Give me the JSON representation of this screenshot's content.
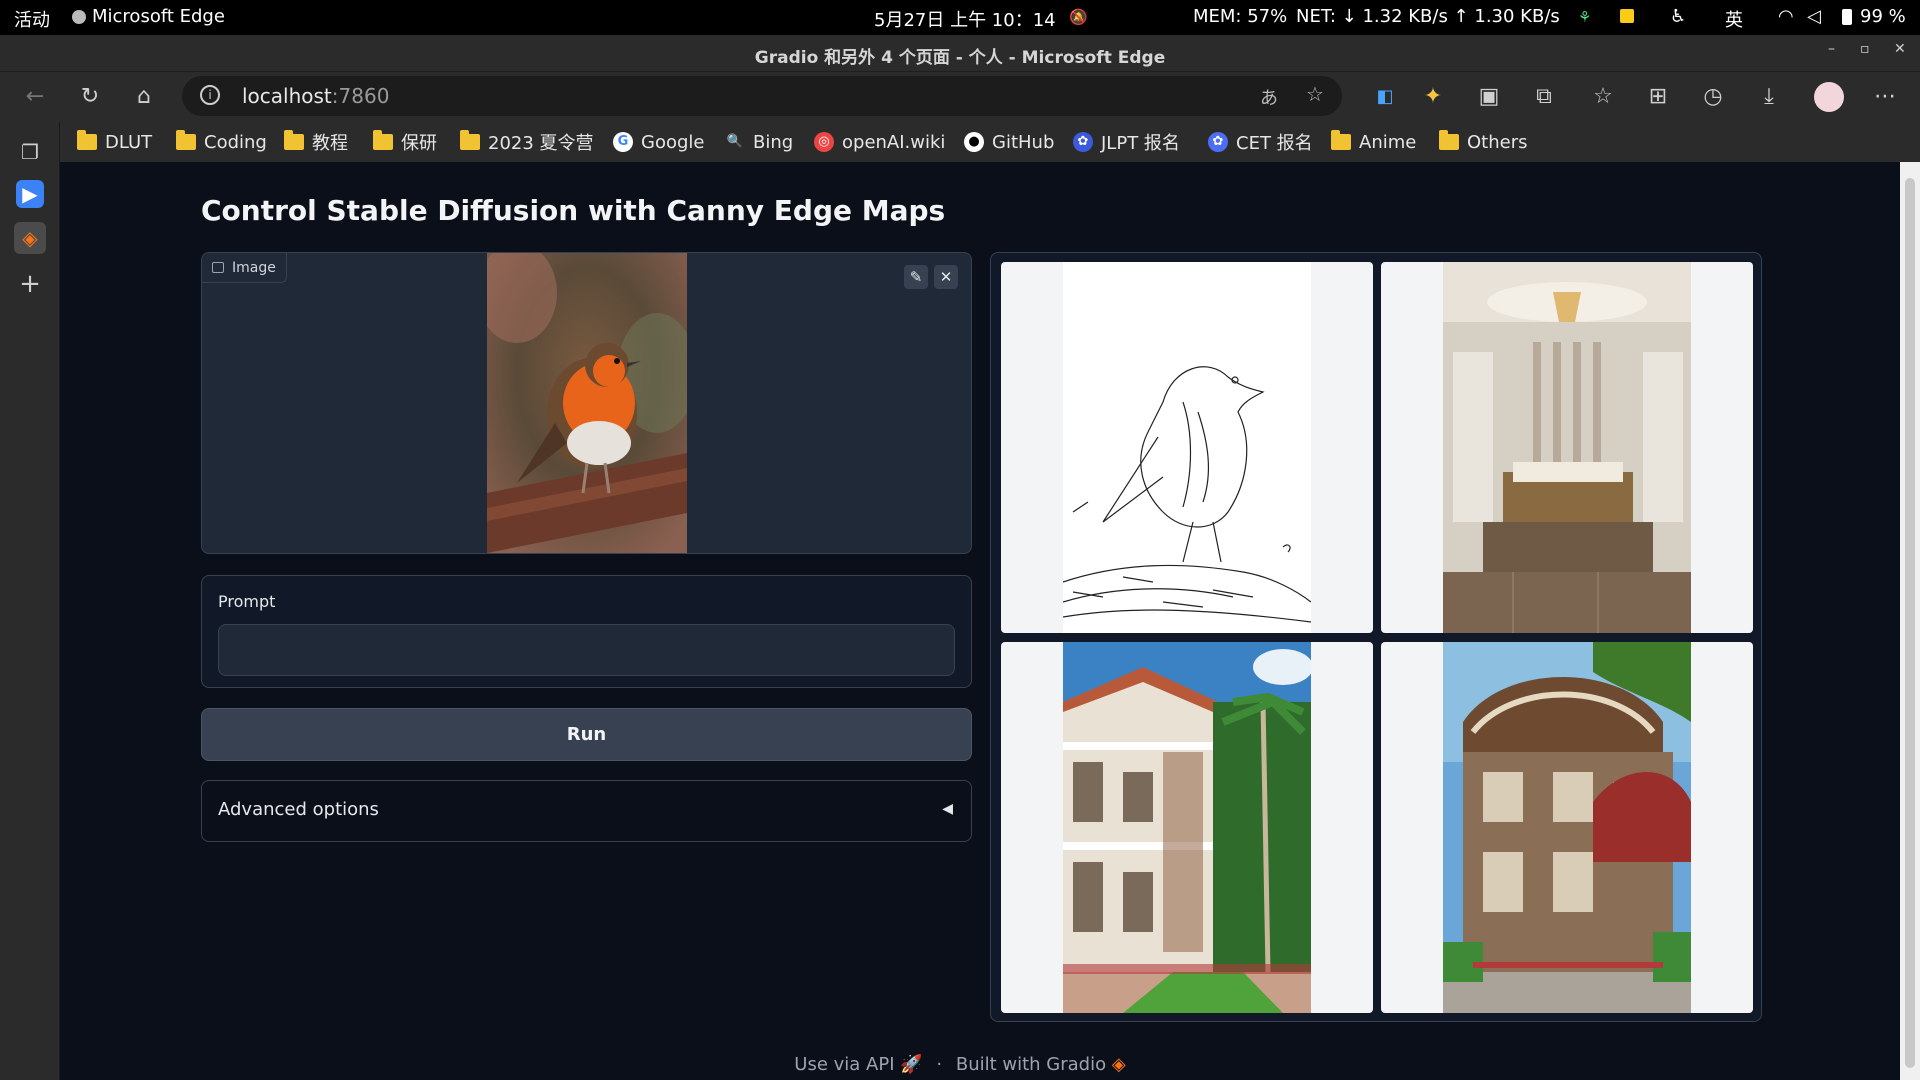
{
  "system_bar": {
    "activities": "活动",
    "app_name": "Microsoft Edge",
    "datetime": "5月27日  上午 10：14",
    "mem": "MEM: 57%",
    "net": "NET: ↓  1.32 KB/s ↑  1.30 KB/s",
    "ime": "英",
    "battery": "99 %"
  },
  "window": {
    "title": "Gradio 和另外 4 个页面 - 个人 - Microsoft Edge"
  },
  "address_bar": {
    "host": "localhost",
    "port": ":7860"
  },
  "bookmarks": [
    {
      "label": "DLUT",
      "icon": "folder-icon"
    },
    {
      "label": "Coding",
      "icon": "folder-icon"
    },
    {
      "label": "教程",
      "icon": "folder-icon"
    },
    {
      "label": "保研",
      "icon": "folder-icon"
    },
    {
      "label": "2023 夏令营",
      "icon": "folder-icon"
    },
    {
      "label": "Google",
      "icon": "google-icon"
    },
    {
      "label": "Bing",
      "icon": "bing-icon"
    },
    {
      "label": "openAI.wiki",
      "icon": "openai-wiki-icon"
    },
    {
      "label": "GitHub",
      "icon": "github-icon"
    },
    {
      "label": "JLPT 报名",
      "icon": "jlpt-icon"
    },
    {
      "label": "CET 报名",
      "icon": "cet-icon"
    },
    {
      "label": "Anime",
      "icon": "folder-icon"
    },
    {
      "label": "Others",
      "icon": "folder-icon"
    }
  ],
  "app": {
    "title": "Control Stable Diffusion with Canny Edge Maps",
    "image_label": "Image",
    "prompt_label": "Prompt",
    "prompt_value": "",
    "run_label": "Run",
    "advanced_label": "Advanced options",
    "advanced_arrow": "◀"
  },
  "footer": {
    "api": "Use via API",
    "separator": "·",
    "built": "Built with Gradio"
  },
  "colors": {
    "page_bg": "#0b0f19",
    "panel_bg": "#111827",
    "border": "#374151",
    "button_bg": "#374151",
    "gradio_orange": "#f97316"
  }
}
